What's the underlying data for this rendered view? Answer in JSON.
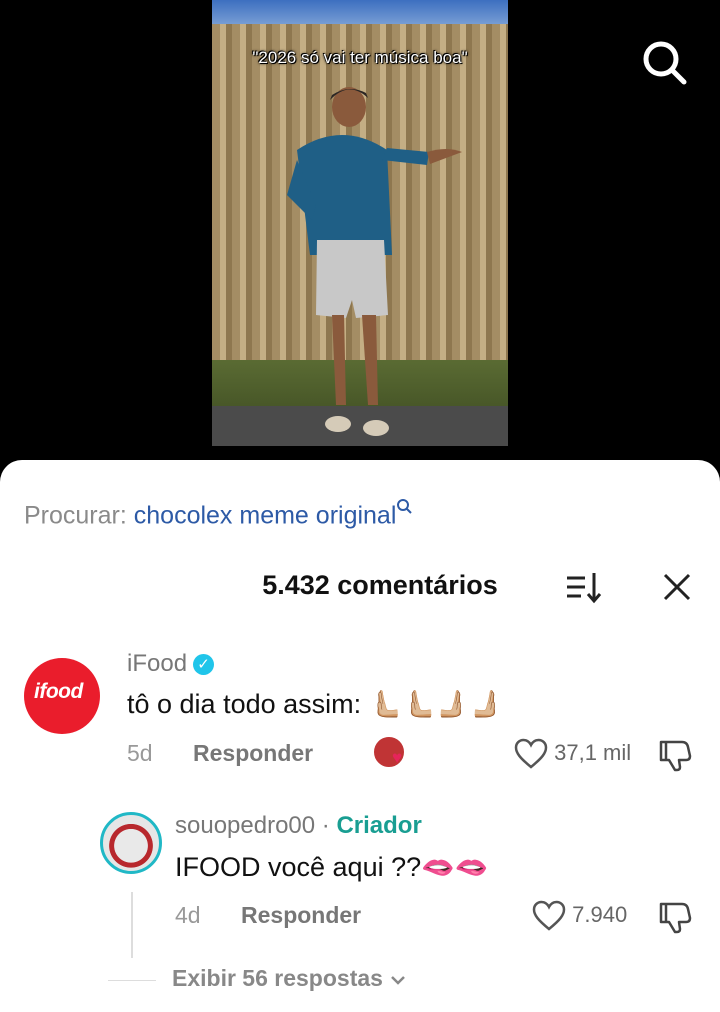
{
  "video": {
    "caption": "\"2026 só vai ter música boa\""
  },
  "search_hint": {
    "prefix": "Procurar:",
    "term": "chocolex meme original"
  },
  "comments_header": {
    "count_text": "5.432 comentários"
  },
  "comments": [
    {
      "username": "iFood",
      "verified": true,
      "avatar_text": "ifood",
      "text": "tô o dia todo assim: ",
      "emojis": "🫷🏼🫷🏼🫸🏼🫸🏼",
      "age": "5d",
      "reply_label": "Responder",
      "likes": "37,1 mil",
      "reply": {
        "username": "souopedro00",
        "separator": " · ",
        "badge": "Criador",
        "text": "IFOOD você aqui ??",
        "emojis": "🫦🫦",
        "age": "4d",
        "reply_label": "Responder",
        "likes": "7.940"
      },
      "view_replies": "Exibir 56 respostas"
    }
  ],
  "colors": {
    "ifood_red": "#ea1d2c",
    "link_blue": "#2d5aa6",
    "creator_teal": "#199e92"
  }
}
